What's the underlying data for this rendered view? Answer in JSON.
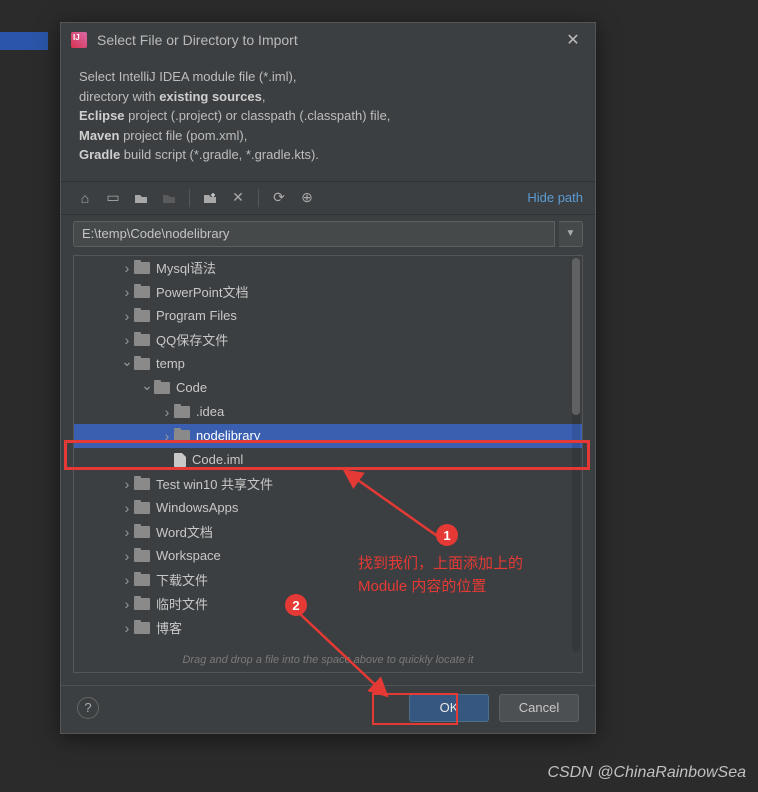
{
  "title": "Select File or Directory to Import",
  "desc_lines": {
    "l1": "Select IntelliJ IDEA module file (*.iml),",
    "l2_pre": "directory with ",
    "l2_b": "existing sources",
    "l2_post": ",",
    "l3_b": "Eclipse",
    "l3_post": " project (.project) or classpath (.classpath) file,",
    "l4_b": "Maven",
    "l4_post": " project file (pom.xml),",
    "l5_b": "Gradle",
    "l5_post": " build script (*.gradle, *.gradle.kts)."
  },
  "toolbar": {
    "hide_path": "Hide path"
  },
  "path": "E:\\temp\\Code\\nodelibrary",
  "tree": {
    "items": [
      {
        "indent": 2,
        "arrow": "right",
        "type": "folder",
        "label": "Mysql语法"
      },
      {
        "indent": 2,
        "arrow": "right",
        "type": "folder",
        "label": "PowerPoint文档"
      },
      {
        "indent": 2,
        "arrow": "right",
        "type": "folder",
        "label": "Program Files"
      },
      {
        "indent": 2,
        "arrow": "right",
        "type": "folder",
        "label": "QQ保存文件"
      },
      {
        "indent": 2,
        "arrow": "down",
        "type": "folder",
        "label": "temp"
      },
      {
        "indent": 3,
        "arrow": "down",
        "type": "folder",
        "label": "Code"
      },
      {
        "indent": 4,
        "arrow": "right",
        "type": "folder",
        "label": ".idea"
      },
      {
        "indent": 4,
        "arrow": "right",
        "type": "folder",
        "label": "nodelibrary",
        "selected": true
      },
      {
        "indent": 4,
        "arrow": "",
        "type": "file",
        "label": "Code.iml"
      },
      {
        "indent": 2,
        "arrow": "right",
        "type": "folder",
        "label": "Test win10 共享文件"
      },
      {
        "indent": 2,
        "arrow": "right",
        "type": "folder",
        "label": "WindowsApps"
      },
      {
        "indent": 2,
        "arrow": "right",
        "type": "folder",
        "label": "Word文档"
      },
      {
        "indent": 2,
        "arrow": "right",
        "type": "folder",
        "label": "Workspace"
      },
      {
        "indent": 2,
        "arrow": "right",
        "type": "folder",
        "label": "下载文件"
      },
      {
        "indent": 2,
        "arrow": "right",
        "type": "folder",
        "label": "临时文件"
      },
      {
        "indent": 2,
        "arrow": "right",
        "type": "folder",
        "label": "博客"
      }
    ],
    "hint": "Drag and drop a file into the space above to quickly locate it"
  },
  "buttons": {
    "ok": "OK",
    "cancel": "Cancel",
    "help": "?"
  },
  "annotations": {
    "n1": "1",
    "n2": "2",
    "text1": "找到我们，上面添加上的",
    "text2": "Module 内容的位置"
  },
  "watermark": "CSDN @ChinaRainbowSea"
}
